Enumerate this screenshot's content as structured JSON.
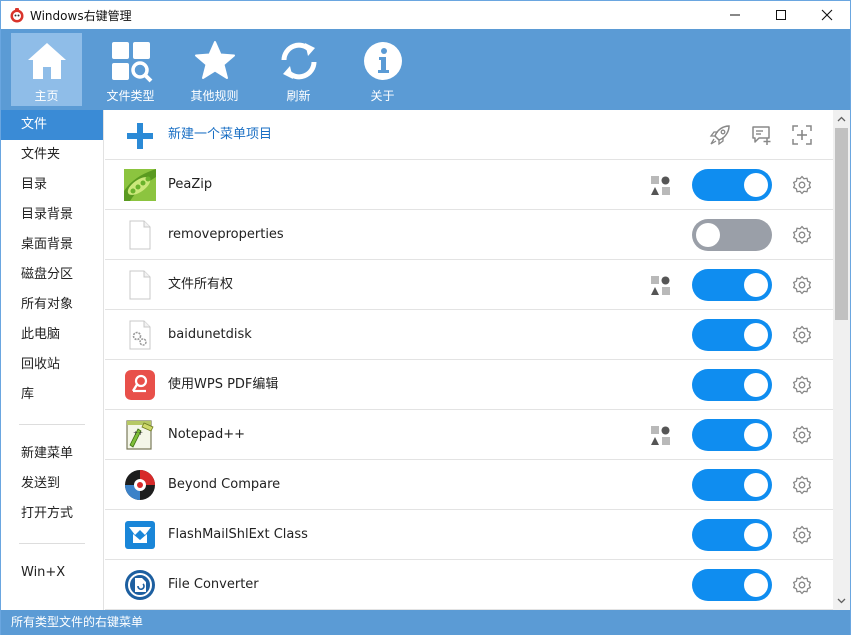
{
  "window": {
    "title": "Windows右键管理"
  },
  "toolbar": {
    "items": [
      {
        "label": "主页",
        "icon": "home-icon",
        "active": true
      },
      {
        "label": "文件类型",
        "icon": "file-types-icon"
      },
      {
        "label": "其他规则",
        "icon": "star-icon"
      },
      {
        "label": "刷新",
        "icon": "refresh-icon"
      },
      {
        "label": "关于",
        "icon": "info-icon"
      }
    ]
  },
  "sidebar": {
    "groups": [
      [
        "文件",
        "文件夹",
        "目录",
        "目录背景",
        "桌面背景",
        "磁盘分区",
        "所有对象",
        "此电脑",
        "回收站",
        "库"
      ],
      [
        "新建菜单",
        "发送到",
        "打开方式"
      ],
      [
        "Win+X"
      ]
    ],
    "active": "文件"
  },
  "list": {
    "new_item": "新建一个菜单项目",
    "rows": [
      {
        "label": "PeaZip",
        "icon": "peazip-icon",
        "enabled": true,
        "shapes": true
      },
      {
        "label": "removeproperties",
        "icon": "blank-file-icon",
        "enabled": false,
        "shapes": false
      },
      {
        "label": "文件所有权",
        "icon": "blank-file-icon",
        "enabled": true,
        "shapes": true
      },
      {
        "label": "baidunetdisk",
        "icon": "settings-file-icon",
        "enabled": true,
        "shapes": false
      },
      {
        "label": "使用WPS PDF编辑",
        "icon": "wps-pdf-icon",
        "enabled": true,
        "shapes": false
      },
      {
        "label": "Notepad++",
        "icon": "notepadpp-icon",
        "enabled": true,
        "shapes": true
      },
      {
        "label": "Beyond Compare",
        "icon": "beyond-compare-icon",
        "enabled": true,
        "shapes": false
      },
      {
        "label": "FlashMailShlExt Class",
        "icon": "flashmail-icon",
        "enabled": true,
        "shapes": false
      },
      {
        "label": "File Converter",
        "icon": "file-converter-icon",
        "enabled": true,
        "shapes": false
      }
    ]
  },
  "statusbar": {
    "text": "所有类型文件的右键菜单"
  },
  "colors": {
    "accent": "#5b9bd5",
    "toggle_on": "#0f8df0",
    "toggle_off": "#9a9fa8",
    "sidebar_active": "#3a8bd6"
  }
}
